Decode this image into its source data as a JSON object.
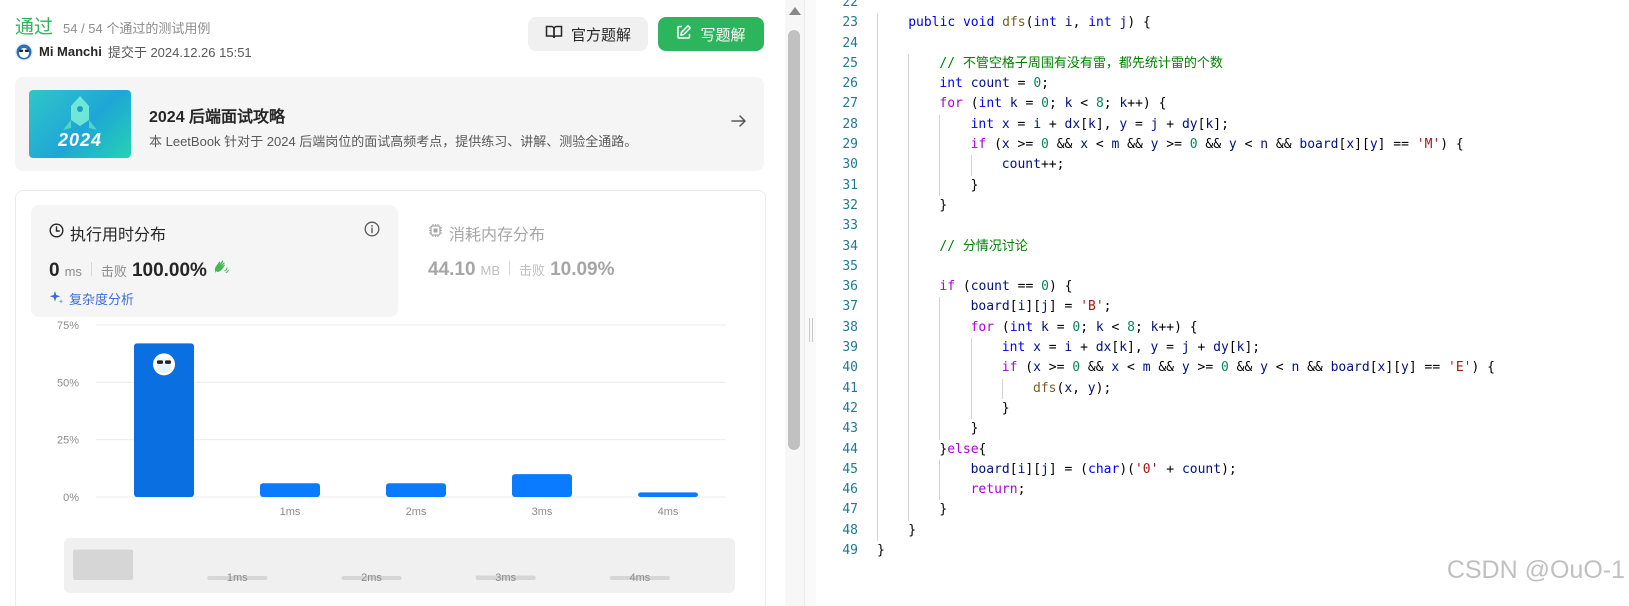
{
  "submission": {
    "status": "通过",
    "test_count": "54 / 54 个通过的测试用例",
    "author": "Mi Manchi",
    "submitted_at": "提交于 2024.12.26 15:51"
  },
  "buttons": {
    "official_solution": "官方题解",
    "write_solution": "写题解"
  },
  "book": {
    "cover_text": "2024",
    "title": "2024 后端面试攻略",
    "description": "本 LeetBook 针对于 2024 后端岗位的面试高频考点，提供练习、讲解、测验全通路。"
  },
  "runtime": {
    "title": "执行用时分布",
    "value": "0",
    "unit": "ms",
    "beat_label": "击败",
    "beat": "100.00%",
    "complexity_link": "复杂度分析"
  },
  "memory": {
    "title": "消耗内存分布",
    "value": "44.10",
    "unit": "MB",
    "beat_label": "击败",
    "beat": "10.09%"
  },
  "chart_data": {
    "type": "bar",
    "categories": [
      "",
      "1ms",
      "2ms",
      "3ms",
      "4ms"
    ],
    "values": [
      67,
      6,
      6,
      10,
      2
    ],
    "ylim": [
      0,
      75
    ],
    "yticks": [
      "75%",
      "50%",
      "25%",
      "0%"
    ],
    "ytick_values": [
      75,
      50,
      25,
      0
    ],
    "bar_color": "#0a7aff",
    "user_bar_color": "#0a6fe0",
    "user_bar_index": 0,
    "overview_values": [
      67,
      6,
      6,
      10,
      2
    ],
    "overview_bar_color": "#d6d6d6",
    "overview_labels": [
      "",
      "1ms",
      "2ms",
      "3ms",
      "4ms"
    ]
  },
  "editor": {
    "lines": [
      {
        "n": "22",
        "indent": 0,
        "tokens": []
      },
      {
        "n": "23",
        "indent": 1,
        "tokens": [
          [
            "kw",
            "public"
          ],
          [
            "p",
            " "
          ],
          [
            "kw",
            "void"
          ],
          [
            "p",
            " "
          ],
          [
            "fn",
            "dfs"
          ],
          [
            "p",
            "("
          ],
          [
            "kw",
            "int"
          ],
          [
            "p",
            " "
          ],
          [
            "var",
            "i"
          ],
          [
            "p",
            ", "
          ],
          [
            "kw",
            "int"
          ],
          [
            "p",
            " "
          ],
          [
            "var",
            "j"
          ],
          [
            "p",
            ") {"
          ]
        ]
      },
      {
        "n": "24",
        "indent": 1,
        "tokens": []
      },
      {
        "n": "25",
        "indent": 2,
        "tokens": [
          [
            "com",
            "// 不管空格子周围有没有雷，都先统计雷的个数"
          ]
        ]
      },
      {
        "n": "26",
        "indent": 2,
        "tokens": [
          [
            "kw",
            "int"
          ],
          [
            "p",
            " "
          ],
          [
            "var",
            "count"
          ],
          [
            "p",
            " = "
          ],
          [
            "num",
            "0"
          ],
          [
            "p",
            ";"
          ]
        ]
      },
      {
        "n": "27",
        "indent": 2,
        "tokens": [
          [
            "ctl",
            "for"
          ],
          [
            "p",
            " ("
          ],
          [
            "kw",
            "int"
          ],
          [
            "p",
            " "
          ],
          [
            "var",
            "k"
          ],
          [
            "p",
            " = "
          ],
          [
            "num",
            "0"
          ],
          [
            "p",
            "; "
          ],
          [
            "var",
            "k"
          ],
          [
            "p",
            " < "
          ],
          [
            "num",
            "8"
          ],
          [
            "p",
            "; "
          ],
          [
            "var",
            "k"
          ],
          [
            "p",
            "++) {"
          ]
        ]
      },
      {
        "n": "28",
        "indent": 3,
        "tokens": [
          [
            "kw",
            "int"
          ],
          [
            "p",
            " "
          ],
          [
            "var",
            "x"
          ],
          [
            "p",
            " = "
          ],
          [
            "var",
            "i"
          ],
          [
            "p",
            " + "
          ],
          [
            "var",
            "dx"
          ],
          [
            "p",
            "["
          ],
          [
            "var",
            "k"
          ],
          [
            "p",
            "], "
          ],
          [
            "var",
            "y"
          ],
          [
            "p",
            " = "
          ],
          [
            "var",
            "j"
          ],
          [
            "p",
            " + "
          ],
          [
            "var",
            "dy"
          ],
          [
            "p",
            "["
          ],
          [
            "var",
            "k"
          ],
          [
            "p",
            "];"
          ]
        ]
      },
      {
        "n": "29",
        "indent": 3,
        "tokens": [
          [
            "ctl",
            "if"
          ],
          [
            "p",
            " ("
          ],
          [
            "var",
            "x"
          ],
          [
            "p",
            " >= "
          ],
          [
            "num",
            "0"
          ],
          [
            "p",
            " && "
          ],
          [
            "var",
            "x"
          ],
          [
            "p",
            " < "
          ],
          [
            "var",
            "m"
          ],
          [
            "p",
            " && "
          ],
          [
            "var",
            "y"
          ],
          [
            "p",
            " >= "
          ],
          [
            "num",
            "0"
          ],
          [
            "p",
            " && "
          ],
          [
            "var",
            "y"
          ],
          [
            "p",
            " < "
          ],
          [
            "var",
            "n"
          ],
          [
            "p",
            " && "
          ],
          [
            "var",
            "board"
          ],
          [
            "p",
            "["
          ],
          [
            "var",
            "x"
          ],
          [
            "p",
            "]["
          ],
          [
            "var",
            "y"
          ],
          [
            "p",
            "] == "
          ],
          [
            "str",
            "'M'"
          ],
          [
            "p",
            ") {"
          ]
        ]
      },
      {
        "n": "30",
        "indent": 4,
        "tokens": [
          [
            "var",
            "count"
          ],
          [
            "p",
            "++;"
          ]
        ]
      },
      {
        "n": "31",
        "indent": 3,
        "tokens": [
          [
            "p",
            "}"
          ]
        ]
      },
      {
        "n": "32",
        "indent": 2,
        "tokens": [
          [
            "p",
            "}"
          ]
        ]
      },
      {
        "n": "33",
        "indent": 2,
        "tokens": []
      },
      {
        "n": "34",
        "indent": 2,
        "tokens": [
          [
            "com",
            "// 分情况讨论"
          ]
        ]
      },
      {
        "n": "35",
        "indent": 2,
        "tokens": []
      },
      {
        "n": "36",
        "indent": 2,
        "tokens": [
          [
            "ctl",
            "if"
          ],
          [
            "p",
            " ("
          ],
          [
            "var",
            "count"
          ],
          [
            "p",
            " == "
          ],
          [
            "num",
            "0"
          ],
          [
            "p",
            ") {"
          ]
        ]
      },
      {
        "n": "37",
        "indent": 3,
        "tokens": [
          [
            "var",
            "board"
          ],
          [
            "p",
            "["
          ],
          [
            "var",
            "i"
          ],
          [
            "p",
            "]["
          ],
          [
            "var",
            "j"
          ],
          [
            "p",
            "] = "
          ],
          [
            "str",
            "'B'"
          ],
          [
            "p",
            ";"
          ]
        ]
      },
      {
        "n": "38",
        "indent": 3,
        "tokens": [
          [
            "ctl",
            "for"
          ],
          [
            "p",
            " ("
          ],
          [
            "kw",
            "int"
          ],
          [
            "p",
            " "
          ],
          [
            "var",
            "k"
          ],
          [
            "p",
            " = "
          ],
          [
            "num",
            "0"
          ],
          [
            "p",
            "; "
          ],
          [
            "var",
            "k"
          ],
          [
            "p",
            " < "
          ],
          [
            "num",
            "8"
          ],
          [
            "p",
            "; "
          ],
          [
            "var",
            "k"
          ],
          [
            "p",
            "++) {"
          ]
        ]
      },
      {
        "n": "39",
        "indent": 4,
        "tokens": [
          [
            "kw",
            "int"
          ],
          [
            "p",
            " "
          ],
          [
            "var",
            "x"
          ],
          [
            "p",
            " = "
          ],
          [
            "var",
            "i"
          ],
          [
            "p",
            " + "
          ],
          [
            "var",
            "dx"
          ],
          [
            "p",
            "["
          ],
          [
            "var",
            "k"
          ],
          [
            "p",
            "], "
          ],
          [
            "var",
            "y"
          ],
          [
            "p",
            " = "
          ],
          [
            "var",
            "j"
          ],
          [
            "p",
            " + "
          ],
          [
            "var",
            "dy"
          ],
          [
            "p",
            "["
          ],
          [
            "var",
            "k"
          ],
          [
            "p",
            "];"
          ]
        ]
      },
      {
        "n": "40",
        "indent": 4,
        "tokens": [
          [
            "ctl",
            "if"
          ],
          [
            "p",
            " ("
          ],
          [
            "var",
            "x"
          ],
          [
            "p",
            " >= "
          ],
          [
            "num",
            "0"
          ],
          [
            "p",
            " && "
          ],
          [
            "var",
            "x"
          ],
          [
            "p",
            " < "
          ],
          [
            "var",
            "m"
          ],
          [
            "p",
            " && "
          ],
          [
            "var",
            "y"
          ],
          [
            "p",
            " >= "
          ],
          [
            "num",
            "0"
          ],
          [
            "p",
            " && "
          ],
          [
            "var",
            "y"
          ],
          [
            "p",
            " < "
          ],
          [
            "var",
            "n"
          ],
          [
            "p",
            " && "
          ],
          [
            "var",
            "board"
          ],
          [
            "p",
            "["
          ],
          [
            "var",
            "x"
          ],
          [
            "p",
            "]["
          ],
          [
            "var",
            "y"
          ],
          [
            "p",
            "] == "
          ],
          [
            "str",
            "'E'"
          ],
          [
            "p",
            ") {"
          ]
        ]
      },
      {
        "n": "41",
        "indent": 5,
        "tokens": [
          [
            "fn",
            "dfs"
          ],
          [
            "p",
            "("
          ],
          [
            "var",
            "x"
          ],
          [
            "p",
            ", "
          ],
          [
            "var",
            "y"
          ],
          [
            "p",
            ");"
          ]
        ]
      },
      {
        "n": "42",
        "indent": 4,
        "tokens": [
          [
            "p",
            "}"
          ]
        ]
      },
      {
        "n": "43",
        "indent": 3,
        "tokens": [
          [
            "p",
            "}"
          ]
        ]
      },
      {
        "n": "44",
        "indent": 2,
        "tokens": [
          [
            "p",
            "}"
          ],
          [
            "ctl",
            "else"
          ],
          [
            "p",
            "{"
          ]
        ]
      },
      {
        "n": "45",
        "indent": 3,
        "tokens": [
          [
            "var",
            "board"
          ],
          [
            "p",
            "["
          ],
          [
            "var",
            "i"
          ],
          [
            "p",
            "]["
          ],
          [
            "var",
            "j"
          ],
          [
            "p",
            "] = ("
          ],
          [
            "kw",
            "char"
          ],
          [
            "p",
            ")("
          ],
          [
            "str",
            "'0'"
          ],
          [
            "p",
            " + "
          ],
          [
            "var",
            "count"
          ],
          [
            "p",
            ");"
          ]
        ]
      },
      {
        "n": "46",
        "indent": 3,
        "tokens": [
          [
            "ctl",
            "return"
          ],
          [
            "p",
            ";"
          ]
        ]
      },
      {
        "n": "47",
        "indent": 2,
        "tokens": [
          [
            "p",
            "}"
          ]
        ]
      },
      {
        "n": "48",
        "indent": 1,
        "tokens": [
          [
            "p",
            "}"
          ]
        ]
      },
      {
        "n": "49",
        "indent": 0,
        "tokens": [
          [
            "p",
            "}"
          ]
        ]
      }
    ]
  },
  "watermark": "CSDN @OuO-1",
  "colors": {
    "accent_green": "#2db55d",
    "bar_blue": "#0a7aff",
    "link_blue": "#3b6fd8"
  },
  "icons": [
    "book-icon",
    "edit-icon",
    "arrow-right-icon",
    "clock-icon",
    "info-icon",
    "clap-icon",
    "sparkle-icon",
    "chip-icon",
    "avatar-icon"
  ]
}
